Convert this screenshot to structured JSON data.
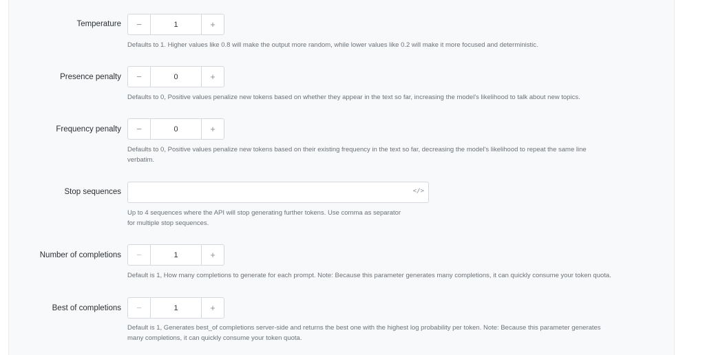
{
  "fields": {
    "temperature": {
      "label": "Temperature",
      "minus": "−",
      "value": "1",
      "plus": "+",
      "help": "Defaults to 1. Higher values like 0.8 will make the output more random, while lower values like 0.2 will make it more focused and deterministic."
    },
    "presence_penalty": {
      "label": "Presence penalty",
      "minus": "−",
      "value": "0",
      "plus": "+",
      "help": "Defaults to 0, Positive values penalize new tokens based on whether they appear in the text so far, increasing the model's likelihood to talk about new topics."
    },
    "frequency_penalty": {
      "label": "Frequency penalty",
      "minus": "−",
      "value": "0",
      "plus": "+",
      "help_line1": "Defaults to 0, Positive values penalize new tokens based on their existing frequency in the text so far, decreasing the model's likelihood to repeat the same line",
      "help_line2": "verbatim."
    },
    "stop_sequences": {
      "label": "Stop sequences",
      "value": "",
      "icon": "code-icon",
      "icon_glyph": "</>",
      "help_line1": "Up to 4 sequences where the API will stop generating further tokens. Use comma as separator",
      "help_line2": "for multiple stop sequences."
    },
    "number_of_completions": {
      "label": "Number of completions",
      "minus": "−",
      "value": "1",
      "plus": "+",
      "help": "Default is 1, How many completions to generate for each prompt. Note: Because this parameter generates many completions, it can quickly consume your token quota."
    },
    "best_of_completions": {
      "label": "Best of completions",
      "minus": "−",
      "value": "1",
      "plus": "+",
      "help_line1": "Default is 1, Generates best_of completions server-side and returns the best one with the highest log probability per token. Note: Because this parameter generates",
      "help_line2": "many completions, it can quickly consume your token quota."
    }
  }
}
